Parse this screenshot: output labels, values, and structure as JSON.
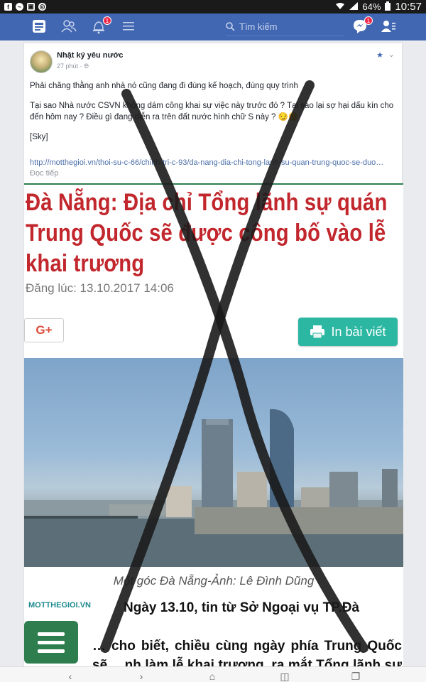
{
  "status_bar": {
    "battery": "64%",
    "time": "10:57"
  },
  "fb_header": {
    "search_placeholder": "Tìm kiếm",
    "notification_count": "1",
    "message_count": "1"
  },
  "post": {
    "author": "Nhật ký yêu nước",
    "time": "27 phút",
    "paragraphs": [
      "Phải chăng thằng anh nhà nó cũng đang đi đúng kế hoạch, đúng quy trình",
      "Tại sao Nhà nước CSVN không dám công khai sự việc này trước đó ? Tại sao lại sợ hại dấu kín cho đến hôm nay ? Điều gì đang diễn ra trên đất nước hình chữ S này ? 😏😏",
      "[Sky]"
    ],
    "link": "http://motthegioi.vn/thoi-su-c-66/chinh-tri-c-93/da-nang-dia-chi-tong-lanh-su-quan-trung-quoc-se-duo…",
    "read_more": "Đọc tiếp"
  },
  "article": {
    "headline": "Đà Nẵng: Địa chỉ Tổng lãnh sự quán Trung Quốc sẽ được công bố vào lễ khai trương",
    "posted": "Đăng lúc: 13.10.2017 14:06",
    "gplus": "G+",
    "print_label": "In bài viết",
    "caption": "Một góc Đà Nẵng-Ảnh: Lê Đình Dũng",
    "source_logo": "MOTTHEGIOI.VN",
    "body_line1": "Ngày 13.10, tin từ Sở Ngoại vụ TP.Đà",
    "body_rest": "… cho biết, chiều cùng ngày phía Trung Quốc sẽ …nh làm lễ khai trương, ra mắt Tổng lãnh sự …ng Quốc tại TP.Đà Nẵng"
  },
  "colors": {
    "fb_blue": "#4267b2",
    "headline_red": "#c1272d",
    "print_green": "#2bb7a2",
    "menu_green": "#2e7d4f"
  }
}
